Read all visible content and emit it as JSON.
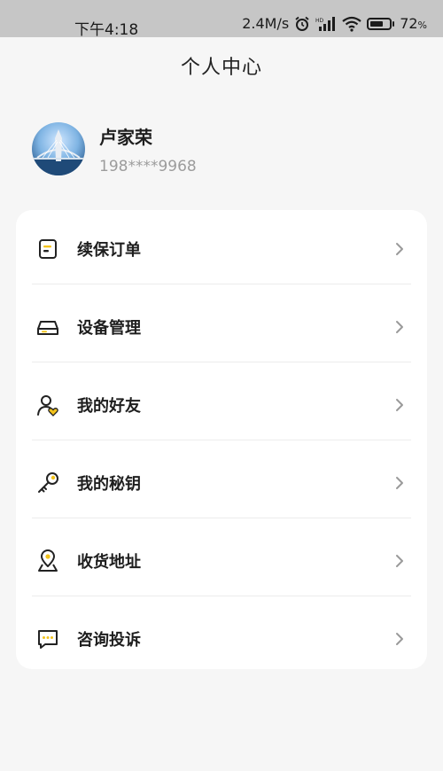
{
  "status_bar": {
    "time": "下午4:18",
    "network_speed": "2.4M/s",
    "battery_percent": "72",
    "battery_unit": "%",
    "battery_level": 0.72,
    "icons": [
      "alarm-icon",
      "hd-signal-icon",
      "wifi-icon",
      "battery-icon"
    ]
  },
  "header": {
    "title": "个人中心"
  },
  "profile": {
    "name": "卢家荣",
    "phone": "198****9968"
  },
  "menu": {
    "items": [
      {
        "label": "续保订单",
        "icon": "renewal-order-icon"
      },
      {
        "label": "设备管理",
        "icon": "device-management-icon"
      },
      {
        "label": "我的好友",
        "icon": "friends-icon"
      },
      {
        "label": "我的秘钥",
        "icon": "key-icon"
      },
      {
        "label": "收货地址",
        "icon": "address-icon"
      },
      {
        "label": "咨询投诉",
        "icon": "complaint-icon"
      }
    ]
  },
  "colors": {
    "accent": "#f2c21b",
    "background": "#f6f6f6",
    "card": "#ffffff",
    "status_bar": "#c6c6c6"
  }
}
